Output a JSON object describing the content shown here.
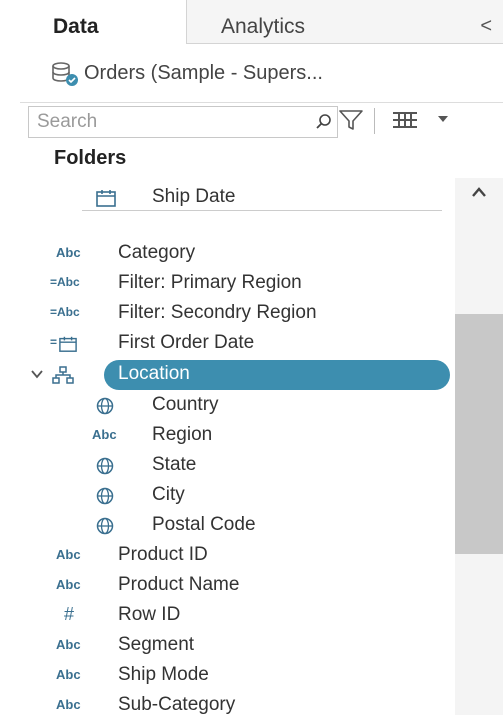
{
  "tabs": {
    "data": "Data",
    "analytics": "Analytics",
    "collapse": "<"
  },
  "datasource": {
    "label": "Orders (Sample - Supers..."
  },
  "search": {
    "placeholder": "Search"
  },
  "folders_title": "Folders",
  "fields": {
    "ship_date": "Ship Date",
    "category": "Category",
    "filter_primary": "Filter: Primary Region",
    "filter_secondary": "Filter: Secondry Region",
    "first_order_date": "First Order Date",
    "location": "Location",
    "country": "Country",
    "region": "Region",
    "state": "State",
    "city": "City",
    "postal_code": "Postal Code",
    "product_id": "Product ID",
    "product_name": "Product Name",
    "row_id": "Row ID",
    "segment": "Segment",
    "ship_mode": "Ship Mode",
    "sub_category": "Sub-Category"
  },
  "type_labels": {
    "abc": "Abc",
    "eq_abc": "=Abc",
    "number": "#",
    "eq": "="
  },
  "colors": {
    "selected": "#3d8eaf",
    "icon": "#3a6f8f"
  }
}
